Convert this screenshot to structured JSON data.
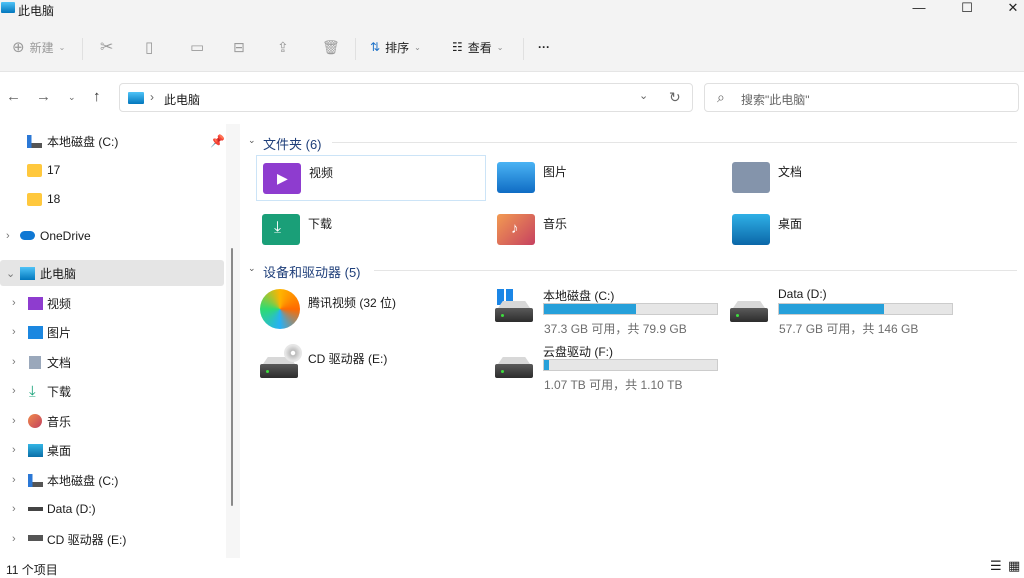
{
  "window": {
    "title": "此电脑",
    "minimize": "—",
    "maximize": "☐",
    "close": "✕"
  },
  "toolbar": {
    "new_label": "新建",
    "sort_label": "排序",
    "view_label": "查看",
    "more_label": "···"
  },
  "address": {
    "path": "此电脑",
    "search_placeholder": "搜索\"此电脑\""
  },
  "sidebar": {
    "quick": [
      {
        "label": "本地磁盘 (C:)"
      },
      {
        "label": "17"
      },
      {
        "label": "18"
      }
    ],
    "onedrive": "OneDrive",
    "thispc": "此电脑",
    "children": [
      {
        "label": "视频"
      },
      {
        "label": "图片"
      },
      {
        "label": "文档"
      },
      {
        "label": "下载"
      },
      {
        "label": "音乐"
      },
      {
        "label": "桌面"
      },
      {
        "label": "本地磁盘 (C:)"
      },
      {
        "label": "Data (D:)"
      },
      {
        "label": "CD 驱动器 (E:)"
      }
    ]
  },
  "folders": {
    "header": "文件夹 (6)",
    "items": [
      {
        "label": "视频"
      },
      {
        "label": "图片"
      },
      {
        "label": "文档"
      },
      {
        "label": "下载"
      },
      {
        "label": "音乐"
      },
      {
        "label": "桌面"
      }
    ]
  },
  "devices": {
    "header": "设备和驱动器 (5)",
    "items": [
      {
        "label": "腾讯视频 (32 位)"
      },
      {
        "label": "本地磁盘 (C:)",
        "capacity": "37.3 GB 可用，共 79.9 GB",
        "used_fraction": 0.533
      },
      {
        "label": "Data (D:)",
        "capacity": "57.7 GB 可用，共 146 GB",
        "used_fraction": 0.605
      },
      {
        "label": "CD 驱动器 (E:)"
      },
      {
        "label": "云盘驱动 (F:)",
        "capacity": "1.07 TB 可用，共 1.10 TB",
        "used_fraction": 0.027
      }
    ]
  },
  "status": {
    "count": "11 个项目"
  },
  "colors": {
    "accent": "#26a0da",
    "selection": "#e5e5e5"
  }
}
